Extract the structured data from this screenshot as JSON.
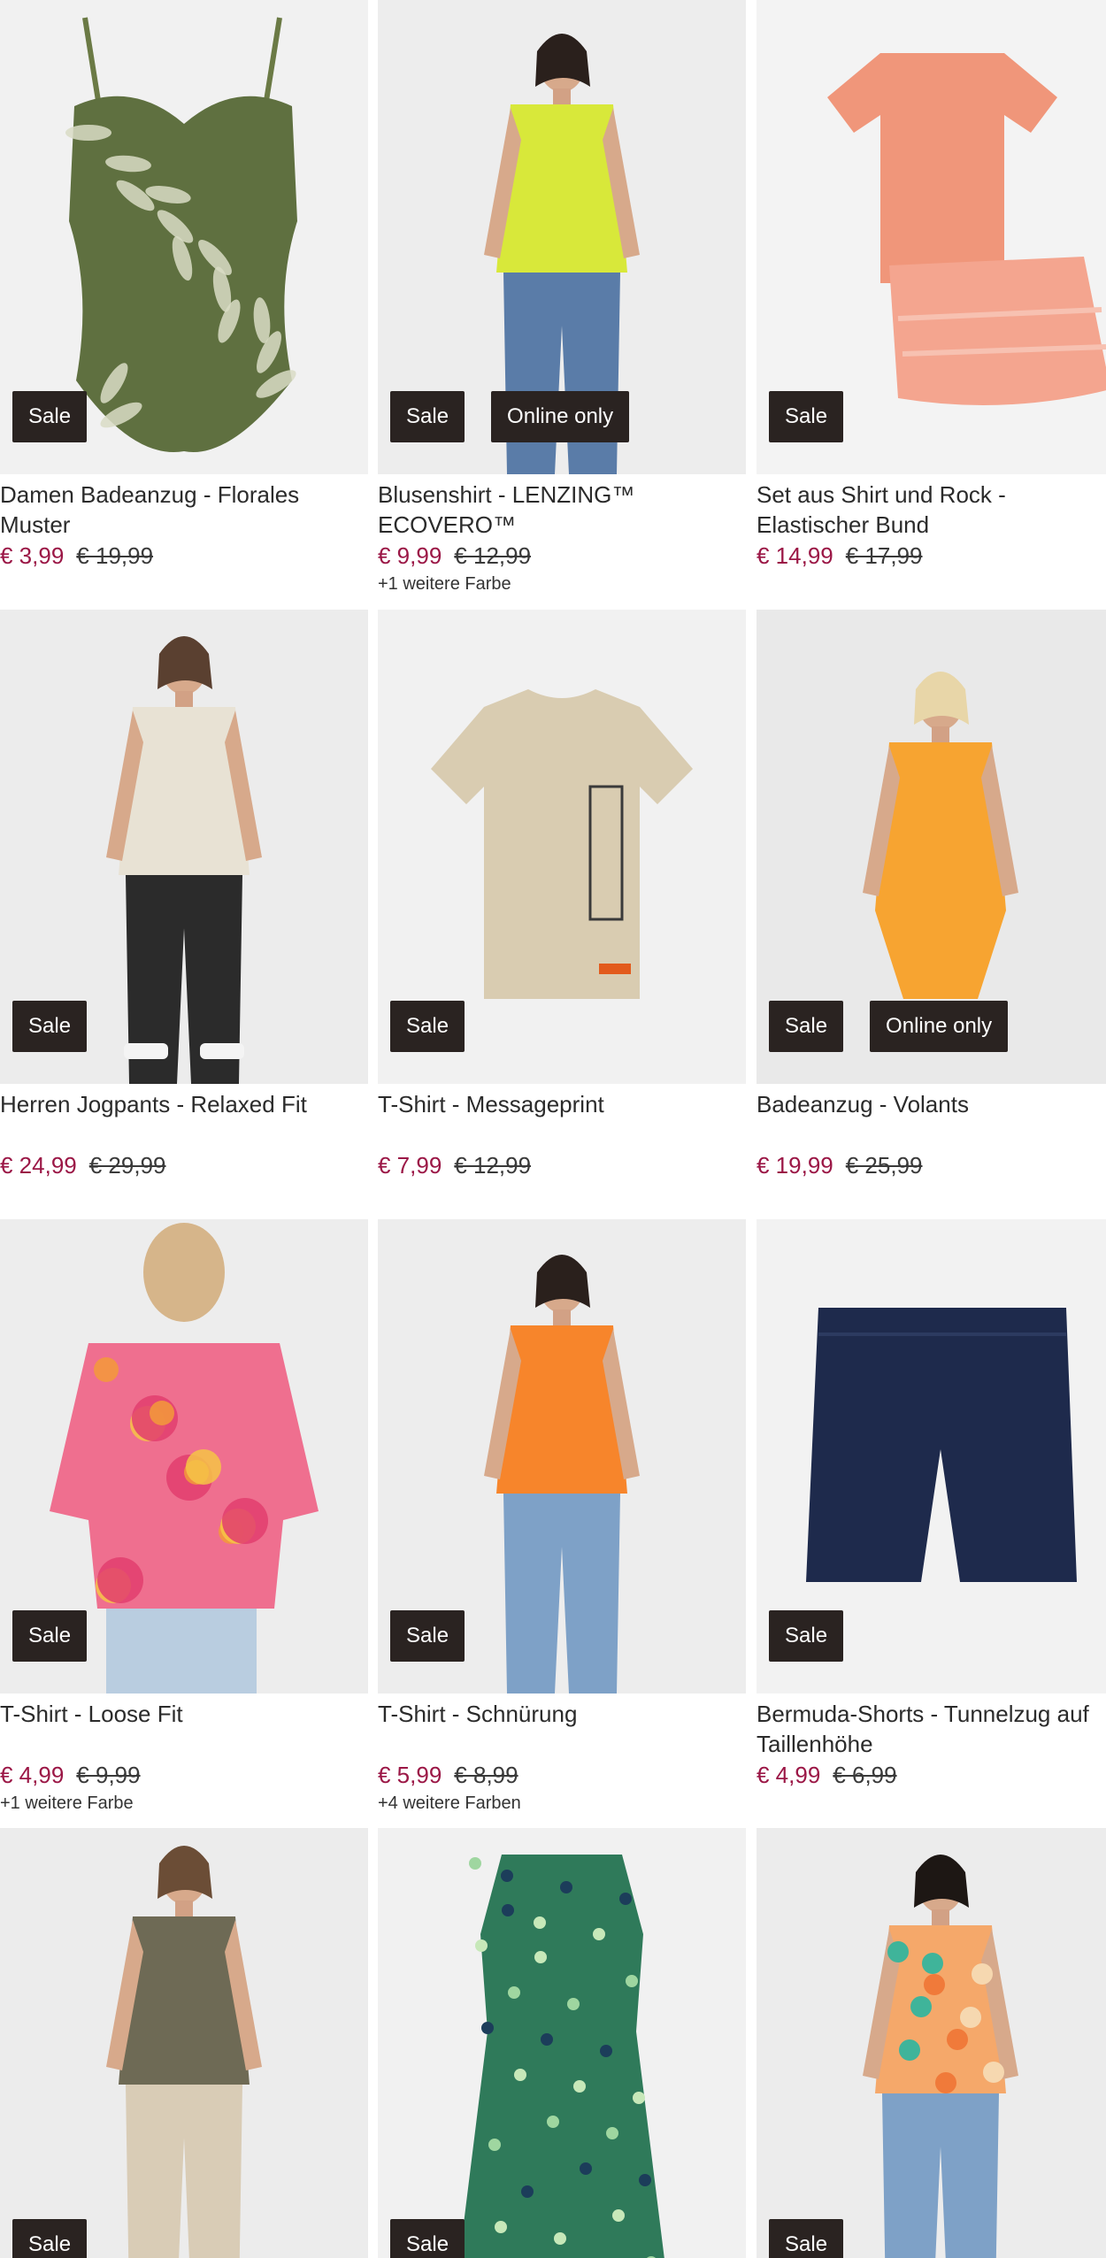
{
  "products": [
    {
      "title": "Damen Badeanzug - Florales Muster",
      "price": "€ 3,99",
      "old_price": "€ 19,99",
      "badges": [
        "Sale"
      ],
      "more_colors": "",
      "image": "floral-swimsuit"
    },
    {
      "title": "Blusenshirt - LENZING™ ECOVERO™",
      "price": "€ 9,99",
      "old_price": "€ 12,99",
      "badges": [
        "Sale",
        "Online only"
      ],
      "more_colors": "+1 weitere Farbe",
      "image": "lime-blouse-model"
    },
    {
      "title": "Set aus Shirt und Rock - Elastischer Bund",
      "price": "€ 14,99",
      "old_price": "€ 17,99",
      "badges": [
        "Sale"
      ],
      "more_colors": "",
      "image": "peach-shirt-skirt-set"
    },
    {
      "title": "Herren Jogpants - Relaxed Fit",
      "price": "€ 24,99",
      "old_price": "€ 29,99",
      "badges": [
        "Sale"
      ],
      "more_colors": "",
      "image": "men-jogpants-model"
    },
    {
      "title": "T-Shirt - Messageprint",
      "price": "€ 7,99",
      "old_price": "€ 12,99",
      "badges": [
        "Sale"
      ],
      "more_colors": "",
      "image": "beige-message-tshirt"
    },
    {
      "title": "Badeanzug - Volants",
      "price": "€ 19,99",
      "old_price": "€ 25,99",
      "badges": [
        "Sale",
        "Online only"
      ],
      "more_colors": "",
      "image": "orange-swimsuit-model"
    },
    {
      "title": "T-Shirt - Loose Fit",
      "price": "€ 4,99",
      "old_price": "€ 9,99",
      "badges": [
        "Sale"
      ],
      "more_colors": "+1 weitere Farbe",
      "image": "paisley-tshirt-model"
    },
    {
      "title": "T-Shirt - Schnürung",
      "price": "€ 5,99",
      "old_price": "€ 8,99",
      "badges": [
        "Sale"
      ],
      "more_colors": "+4 weitere Farben",
      "image": "orange-tshirt-model"
    },
    {
      "title": "Bermuda-Shorts - Tunnelzug auf Taillenhöhe",
      "price": "€ 4,99",
      "old_price": "€ 6,99",
      "badges": [
        "Sale"
      ],
      "more_colors": "",
      "image": "navy-bermuda-shorts"
    },
    {
      "title": "",
      "price": "",
      "old_price": "",
      "badges": [
        "Sale"
      ],
      "more_colors": "",
      "image": "olive-tshirt-model"
    },
    {
      "title": "",
      "price": "",
      "old_price": "",
      "badges": [
        "Sale"
      ],
      "more_colors": "",
      "image": "green-print-dress"
    },
    {
      "title": "",
      "price": "",
      "old_price": "",
      "badges": [
        "Sale"
      ],
      "more_colors": "",
      "image": "paisley-plus-tshirt-model"
    }
  ],
  "colors": {
    "badge_bg": "#2a2321",
    "sale_price": "#9b1746",
    "image_bg": "#eeeeee"
  }
}
